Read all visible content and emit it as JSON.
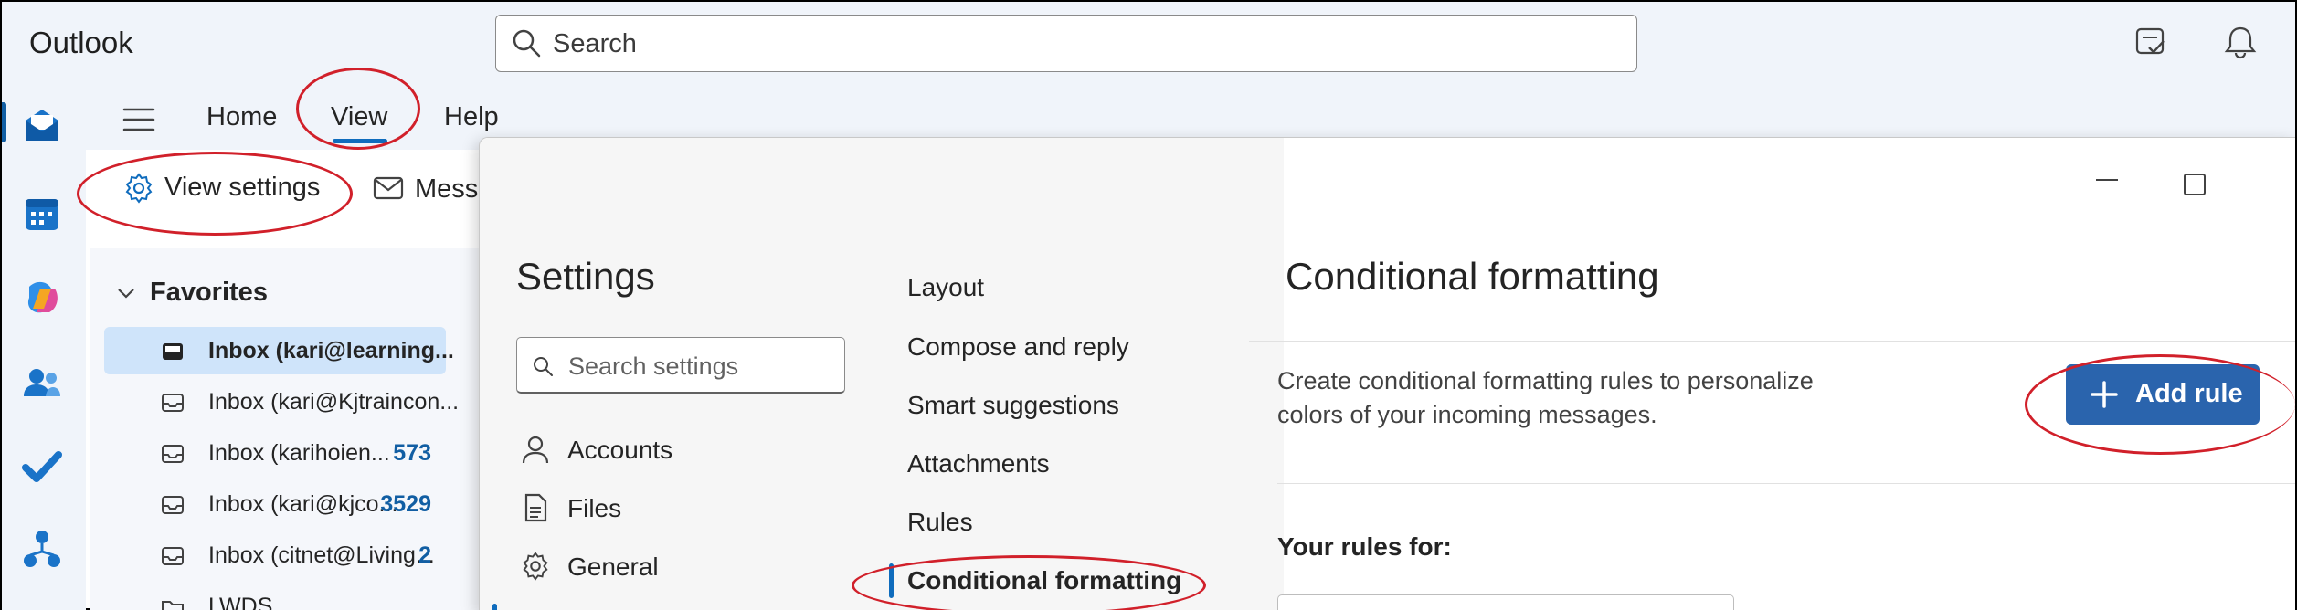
{
  "app": {
    "title": "Outlook"
  },
  "search": {
    "placeholder": "Search"
  },
  "header_icons": [
    "todo-icon",
    "bell-icon"
  ],
  "rail": {
    "icons": [
      "mail-icon",
      "calendar-icon",
      "copilot-icon",
      "people-icon",
      "todo-check-icon",
      "org-explorer-icon"
    ]
  },
  "ribbon": {
    "tabs": [
      {
        "label": "Home"
      },
      {
        "label": "View",
        "selected": true
      },
      {
        "label": "Help"
      }
    ],
    "view_settings_label": "View settings",
    "message_label": "Messa"
  },
  "folder_pane": {
    "favorites_label": "Favorites",
    "items": [
      {
        "label": "Inbox (kari@learning...",
        "count": "",
        "selected": true
      },
      {
        "label": "Inbox (kari@Kjtraincon...",
        "count": ""
      },
      {
        "label": "Inbox (karihoien...",
        "count": "573"
      },
      {
        "label": "Inbox (kari@kjco...",
        "count": "3529"
      },
      {
        "label": "Inbox (citnet@Living...",
        "count": "2"
      },
      {
        "label": "LWDS",
        "count": ""
      }
    ]
  },
  "settings": {
    "title": "Settings",
    "search_placeholder": "Search settings",
    "categories": [
      {
        "label": "Accounts",
        "icon": "person-icon"
      },
      {
        "label": "Files",
        "icon": "file-icon"
      },
      {
        "label": "General",
        "icon": "gear-icon"
      }
    ],
    "subcategories": [
      {
        "label": "Layout"
      },
      {
        "label": "Compose and reply"
      },
      {
        "label": "Smart suggestions"
      },
      {
        "label": "Attachments"
      },
      {
        "label": "Rules"
      },
      {
        "label": "Conditional formatting",
        "selected": true
      }
    ],
    "content": {
      "title": "Conditional formatting",
      "description": "Create conditional formatting rules to personalize colors of your incoming messages.",
      "add_rule_label": "Add rule",
      "rules_for_label": "Your rules for:"
    }
  },
  "colors": {
    "accent": "#0f6cbd",
    "add_rule_bg": "#2a64ad",
    "annotation": "#d1202a",
    "selected_item": "#cfe4fa"
  }
}
